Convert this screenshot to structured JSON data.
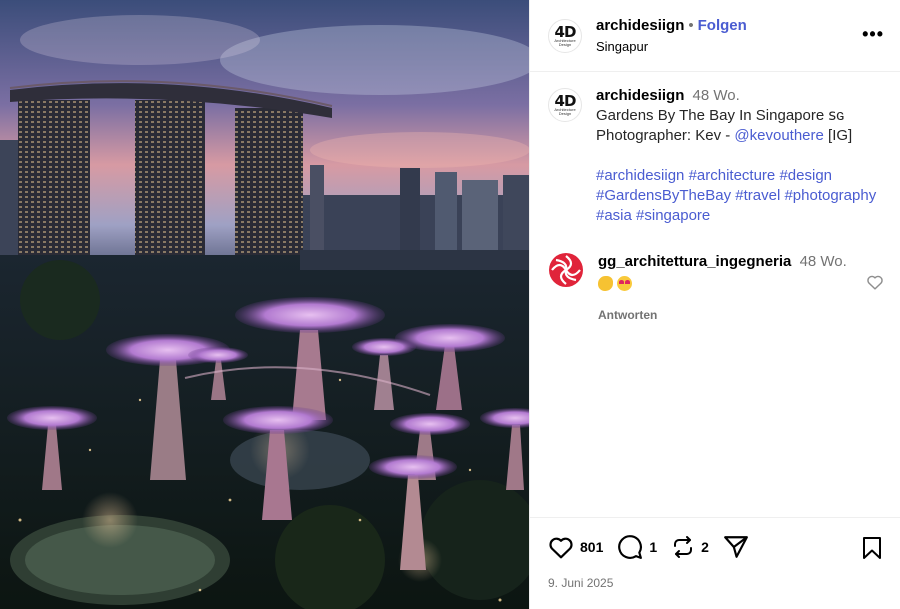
{
  "post": {
    "photo_alt": "",
    "author": {
      "username": "archidesiign",
      "follow_label": "Folgen",
      "separator": "•",
      "location": "Singapur",
      "avatar_text": "4D",
      "avatar_subtext": "Architecture Design"
    },
    "more_label": "•••",
    "caption": {
      "username": "archidesiign",
      "time": "48 Wo.",
      "line1": "Gardens By The Bay In Singapore ꜱɢ",
      "line2_prefix": "Photographer: Kev - ",
      "mention": "@kevouthere",
      "line2_suffix": " [IG]",
      "hashtags_line1": [
        "#archidesiign",
        "#architecture",
        "#design"
      ],
      "hashtags_line2": [
        "#GardensByTheBay",
        "#travel",
        "#photography"
      ],
      "hashtags_line3": [
        "#asia",
        "#singapore"
      ]
    },
    "comment": {
      "username": "gg_architettura_ingegneria",
      "time": "48 Wo.",
      "emojis": [
        "clap",
        "heart-eyes"
      ],
      "reply_label": "Antworten"
    },
    "actions": {
      "likes": "801",
      "comments": "1",
      "reposts": "2"
    },
    "date": "9. Juni 2025",
    "colors": {
      "link": "#4a5cd1",
      "muted": "#737373",
      "border": "#efefef",
      "comment_avatar": "#e0243a"
    },
    "icons": {
      "more": "ellipsis-icon",
      "like": "heart-icon",
      "comment": "comment-bubble-icon",
      "repost": "repost-icon",
      "share": "paper-plane-icon",
      "save": "bookmark-icon"
    }
  }
}
